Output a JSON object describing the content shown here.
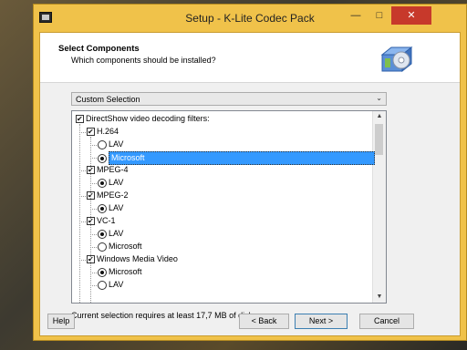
{
  "window": {
    "title": "Setup - K-Lite Codec Pack",
    "min": "—",
    "max": "□",
    "close": "✕"
  },
  "header": {
    "title": "Select Components",
    "subtitle": "Which components should be installed?"
  },
  "selection": {
    "value": "Custom Selection"
  },
  "tree": [
    {
      "label": "DirectShow video decoding filters:",
      "kind": "checkbox",
      "checked": true
    },
    {
      "label": "H.264",
      "kind": "checkbox",
      "checked": true
    },
    {
      "label": "LAV",
      "kind": "radio",
      "selected": false
    },
    {
      "label": "Microsoft",
      "kind": "radio",
      "selected": true,
      "highlighted": true
    },
    {
      "label": "MPEG-4",
      "kind": "checkbox",
      "checked": true
    },
    {
      "label": "LAV",
      "kind": "radio",
      "selected": true
    },
    {
      "label": "MPEG-2",
      "kind": "checkbox",
      "checked": true
    },
    {
      "label": "LAV",
      "kind": "radio",
      "selected": true
    },
    {
      "label": "VC-1",
      "kind": "checkbox",
      "checked": true
    },
    {
      "label": "LAV",
      "kind": "radio",
      "selected": true
    },
    {
      "label": "Microsoft",
      "kind": "radio",
      "selected": false
    },
    {
      "label": "Windows Media Video",
      "kind": "checkbox",
      "checked": true
    },
    {
      "label": "Microsoft",
      "kind": "radio",
      "selected": true
    },
    {
      "label": "LAV",
      "kind": "radio",
      "selected": false
    }
  ],
  "status": "Current selection requires at least 17,7 MB of disk space.",
  "buttons": {
    "help": "Help",
    "back": "< Back",
    "next": "Next >",
    "cancel": "Cancel"
  },
  "colors": {
    "frame": "#f0c24a",
    "close": "#c7392b",
    "highlight": "#3399ff"
  }
}
